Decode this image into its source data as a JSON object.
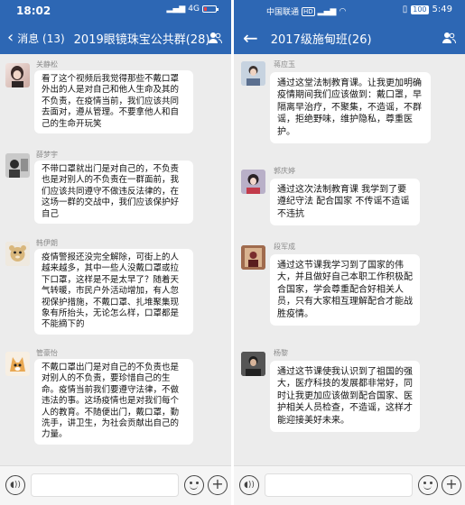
{
  "left": {
    "status": {
      "time": "18:02",
      "network": "4G"
    },
    "header": {
      "back_label": "消息 (13)",
      "title": "2019眼镜珠宝公共群(28)"
    },
    "messages": [
      {
        "sender": "关静松",
        "text": "看了这个视频后我觉得那些不戴口罩外出的人是对自己和他人生命及其的不负责，在疫情当前，我们应该共同去面对，遵从管理。不要拿他人和自己的生命开玩笑"
      },
      {
        "sender": "薛梦宇",
        "text": "不带口罩就出门是对自己的，不负责也是对别人的不负责在一群面前，我们应该共同遵守不做违反法律的，在这场一群的交战中，我们应该保护好自己"
      },
      {
        "sender": "韩伊朗",
        "text": "疫情警报还没完全解除，可街上的人越来越多，其中一些人没戴口罩或拉下口罩，这样是不是太早了？随着天气转暖，市民户外活动增加，有人忽视保护措施，不戴口罩、扎堆聚集现象有所抬头，无论怎么样，口罩都是不能摘下的"
      },
      {
        "sender": "管豪怡",
        "text": "不戴口罩出门是对自己的不负责也是对别人的不负责，要珍惜自己的生命。疫情当前我们要遵守法律，不做违法的事。这场疫情也是对我们每个人的教育。不随便出门，戴口罩，勤洗手，讲卫生，为社会贡献出自己的力量。"
      }
    ]
  },
  "right": {
    "status": {
      "carrier": "中国联通",
      "carrier_tag": "HD",
      "battery": "100",
      "time": "5:49"
    },
    "header": {
      "title": "2017级施甸班(26)"
    },
    "messages": [
      {
        "sender": "蒋应玉",
        "text": "通过这堂法制教育课。让我更加明确疫情期间我们应该做到：戴口罩，早隔离早治疗，不聚集，不造谣，不群谣，拒绝野味，维护隐私，尊重医护。"
      },
      {
        "sender": "郭庆婷",
        "text": "通过这次法制教育课 我学到了要遵纪守法 配合国家 不传谣不造谣 不违抗"
      },
      {
        "sender": "段军成",
        "text": "通过这节课我学习到了国家的伟大，并且做好自己本职工作积极配合国家，学会尊重配合好相关人员，只有大家相互理解配合才能战胜疫情。"
      },
      {
        "sender": "杨黎",
        "text": "通过这节课使我认识到了祖国的强大，医疗科技的发展都非常好，同时让我更加应该做到配合国家、医护相关人员检查，不造谣，这样才能迎接美好未来。"
      }
    ]
  },
  "colors": {
    "header_blue": "#2d67b4",
    "chat_bg": "#ececec",
    "bubble": "#ffffff"
  },
  "icons": [
    "back-icon",
    "group-members-icon",
    "voice-icon",
    "emoji-icon",
    "plus-icon"
  ]
}
